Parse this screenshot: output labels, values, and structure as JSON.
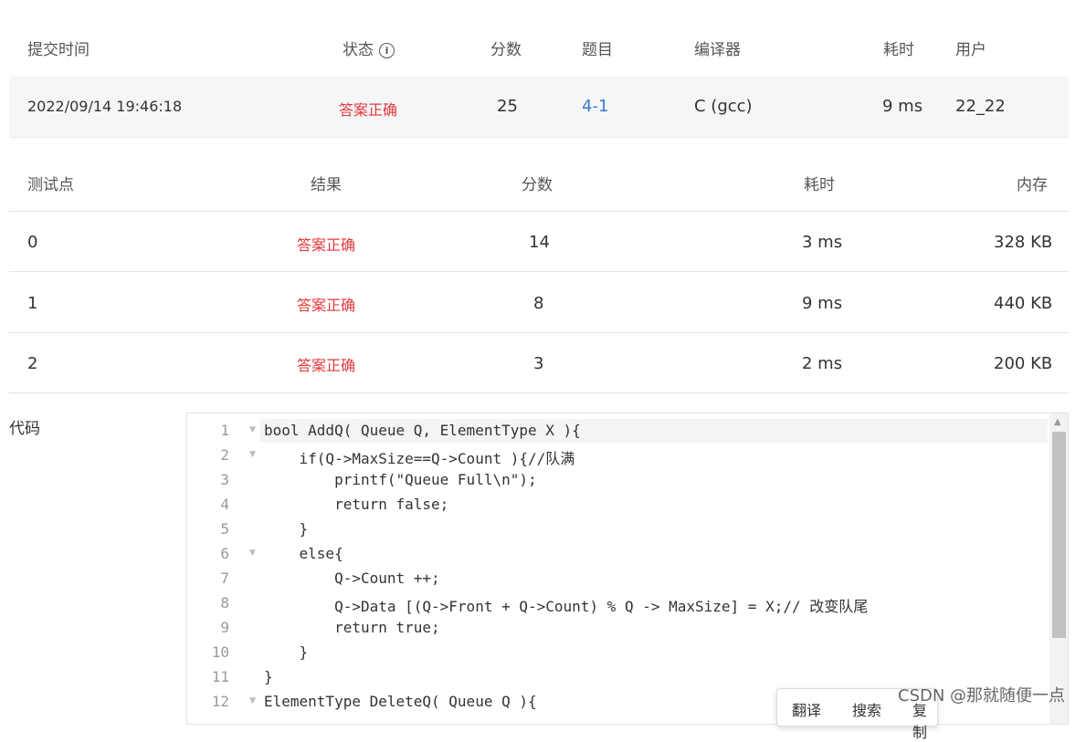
{
  "submission_header": {
    "time": "提交时间",
    "status": "状态",
    "score": "分数",
    "problem": "题目",
    "compiler": "编译器",
    "duration": "耗时",
    "user": "用户"
  },
  "submission": {
    "time": "2022/09/14 19:46:18",
    "status": "答案正确",
    "score": "25",
    "problem": "4-1",
    "compiler": "C (gcc)",
    "duration": "9 ms",
    "user": "22_22"
  },
  "tests_header": {
    "point": "测试点",
    "result": "结果",
    "score": "分数",
    "duration": "耗时",
    "memory": "内存"
  },
  "tests": [
    {
      "point": "0",
      "result": "答案正确",
      "score": "14",
      "duration": "3 ms",
      "memory": "328 KB"
    },
    {
      "point": "1",
      "result": "答案正确",
      "score": "8",
      "duration": "9 ms",
      "memory": "440 KB"
    },
    {
      "point": "2",
      "result": "答案正确",
      "score": "3",
      "duration": "2 ms",
      "memory": "200 KB"
    }
  ],
  "code_label": "代码",
  "code_lines": [
    {
      "n": "1",
      "text": "bool AddQ( Queue Q, ElementType X ){"
    },
    {
      "n": "2",
      "text": "    if(Q->MaxSize==Q->Count ){//队满"
    },
    {
      "n": "3",
      "text": "        printf(\"Queue Full\\n\");"
    },
    {
      "n": "4",
      "text": "        return false;"
    },
    {
      "n": "5",
      "text": "    }"
    },
    {
      "n": "6",
      "text": "    else{"
    },
    {
      "n": "7",
      "text": "        Q->Count ++;"
    },
    {
      "n": "8",
      "text": "        Q->Data [(Q->Front + Q->Count) % Q -> MaxSize] = X;// 改变队尾"
    },
    {
      "n": "9",
      "text": "        return true;"
    },
    {
      "n": "10",
      "text": "    }"
    },
    {
      "n": "11",
      "text": "}"
    },
    {
      "n": "12",
      "text": "ElementType DeleteQ( Queue Q ){"
    }
  ],
  "popup": {
    "translate": "翻译",
    "search": "搜索",
    "copy": "复制"
  },
  "watermark": "CSDN @那就随便一点",
  "colors": {
    "status_ok": "#e5373b",
    "link": "#3a7bd5"
  }
}
